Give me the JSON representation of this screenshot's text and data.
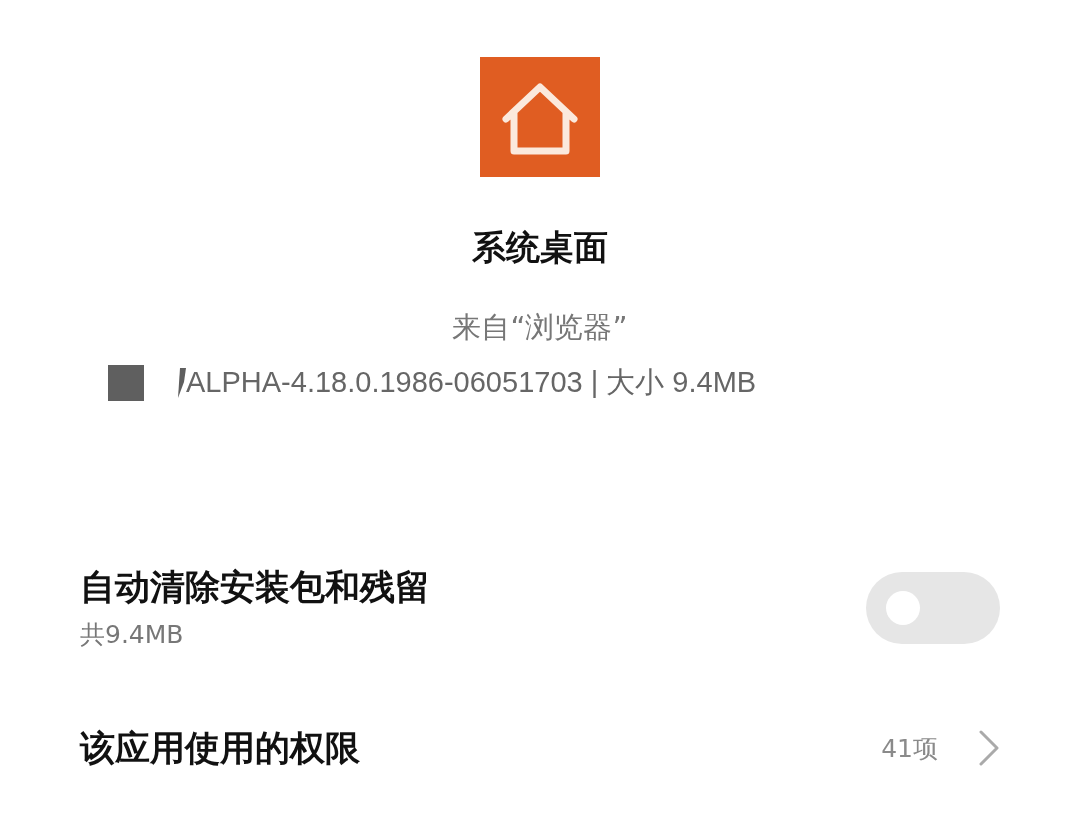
{
  "app": {
    "name": "系统桌面",
    "source": "来自“浏览器”",
    "version_info": "ALPHA-4.18.0.1986-06051703 | 大小 9.4MB"
  },
  "settings": [
    {
      "kind": "toggle",
      "title": "自动清除安装包和残留",
      "subtitle": "共9.4MB",
      "on": false
    },
    {
      "kind": "link",
      "title": "该应用使用的权限",
      "value": "41项"
    }
  ]
}
